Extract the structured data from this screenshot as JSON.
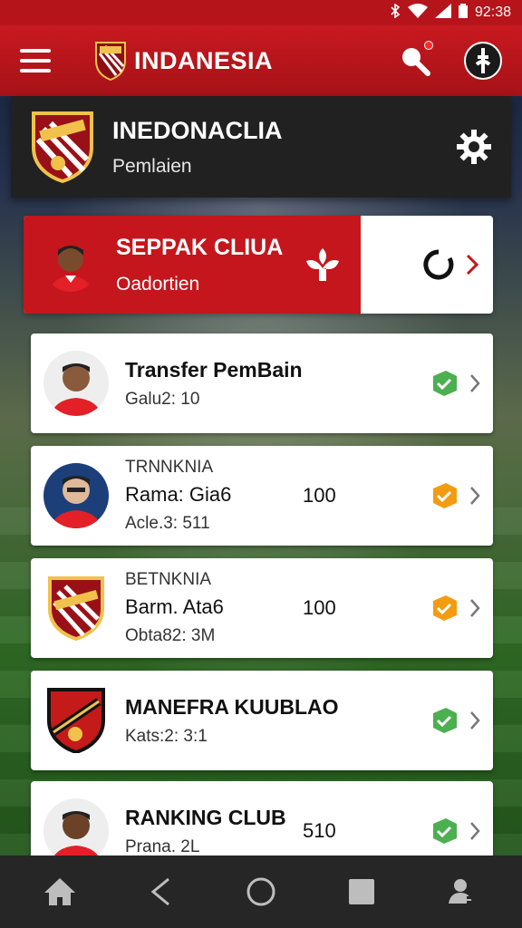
{
  "status_bar": {
    "time": "92:38",
    "icons": [
      "bluetooth-icon",
      "wifi-icon",
      "signal-icon",
      "battery-icon"
    ]
  },
  "app_bar": {
    "title": "INDANESIA",
    "icons": [
      "menu-icon",
      "search-icon",
      "profile-icon"
    ]
  },
  "header": {
    "title": "INEDONACLIA",
    "subtitle": "Pemlaien"
  },
  "feature": {
    "title": "SEPPAK CLIUA",
    "subtitle": "Oadortien"
  },
  "list": [
    {
      "kicker": "",
      "title": "Transfer PemBain",
      "sub": "Galu2: 10",
      "value": "",
      "status": "green"
    },
    {
      "kicker": "TRNNKNIA",
      "title": "Rama: Gia6",
      "sub": "Acle.3: 511",
      "value": "100",
      "status": "orange"
    },
    {
      "kicker": "BETNKNIA",
      "title": "Barm. Ata6",
      "sub": "Obta82: 3M",
      "value": "100",
      "status": "orange"
    },
    {
      "kicker": "",
      "title": "MANEFRA KUUBLAO",
      "sub": "Kats:2: 3:1",
      "value": "",
      "status": "green"
    },
    {
      "kicker": "",
      "title": "RANKING CLUB",
      "sub": "Prana. 2L",
      "value": "510",
      "status": "green"
    }
  ],
  "colors": {
    "brand_red": "#c4161c",
    "dark": "#212121",
    "green": "#4caf50",
    "orange": "#f39c12"
  }
}
